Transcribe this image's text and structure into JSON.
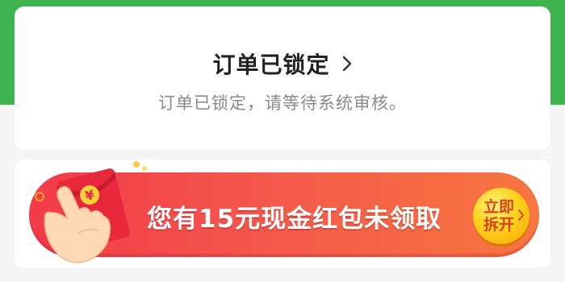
{
  "order_status": {
    "title": "订单已锁定",
    "description": "订单已锁定，请等待系统审核。"
  },
  "promo": {
    "banner_text": "您有15元现金红包未领取",
    "claim_button_lines": [
      "立即",
      "拆开"
    ],
    "envelope_symbol": "¥",
    "icons": [
      "red-envelope-icon",
      "hand-icon",
      "chevron-right-icon"
    ]
  },
  "colors": {
    "header_green": "#3fb34f",
    "banner_red": "#f23a4a",
    "banner_orange": "#f7763f",
    "button_yellow": "#ffd11c",
    "button_text": "#d8421b"
  }
}
